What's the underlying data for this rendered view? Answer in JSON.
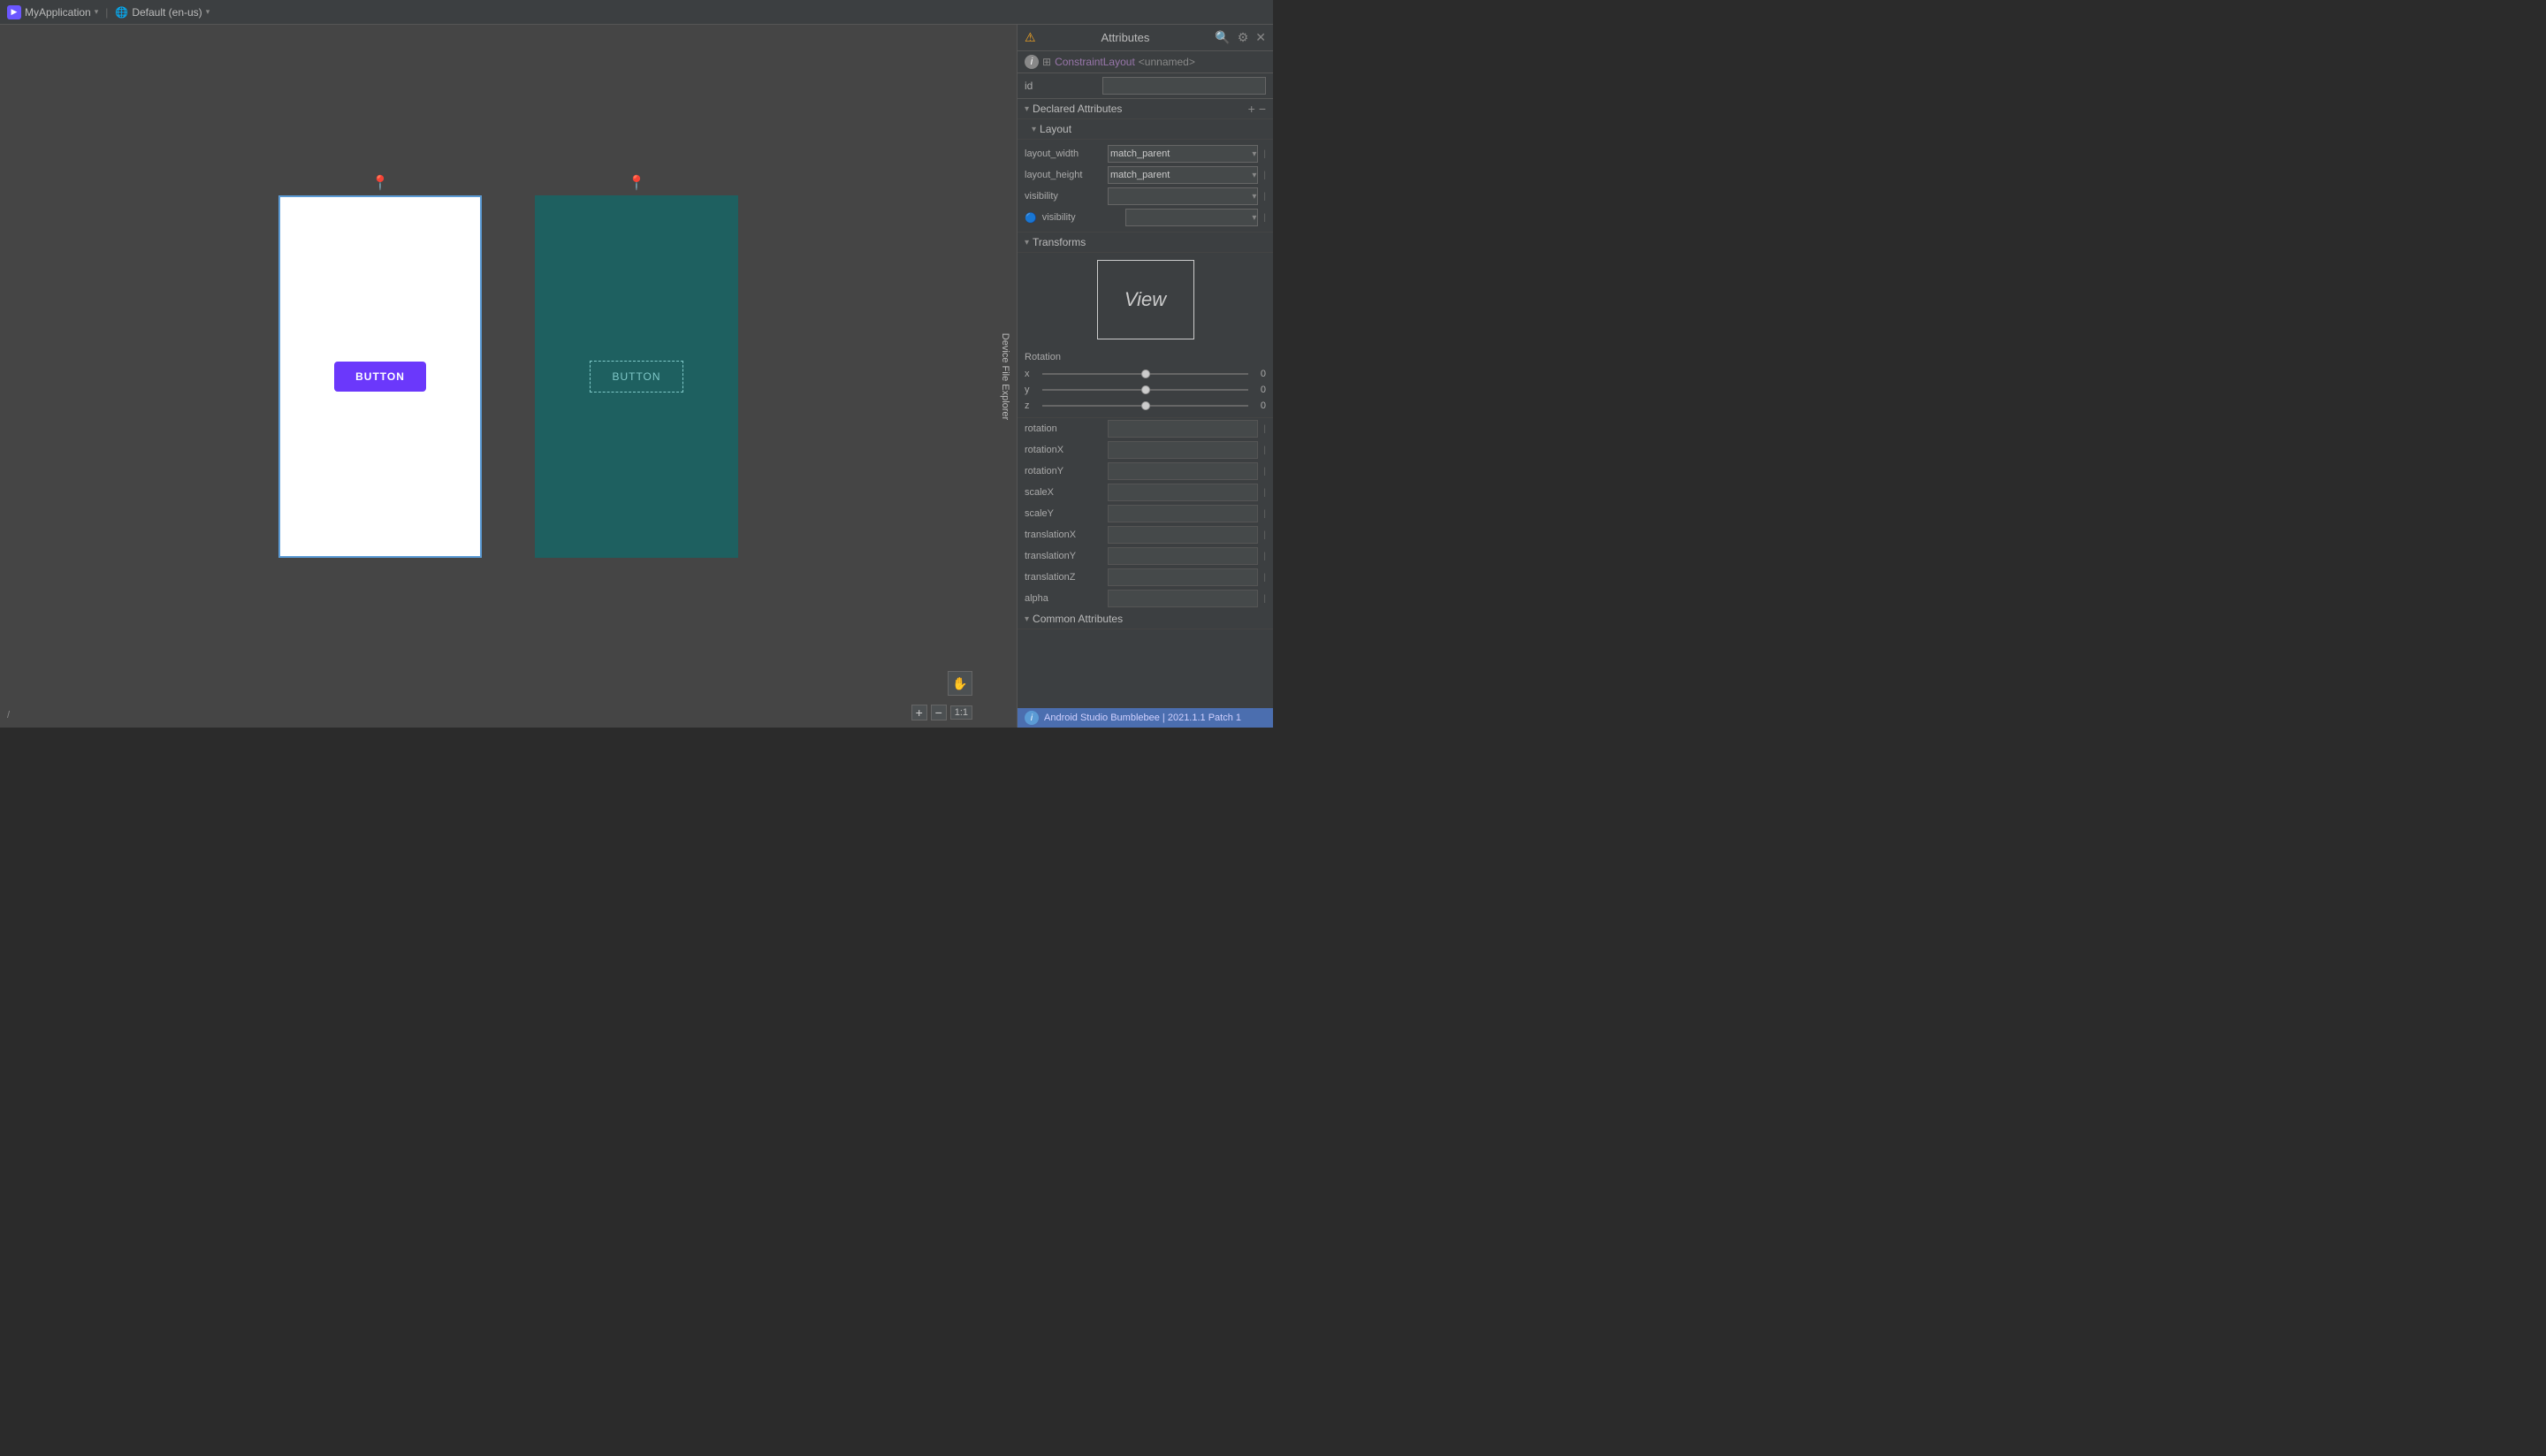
{
  "topbar": {
    "app_name": "MyApplication",
    "config_name": "Default (en-us)",
    "app_icon": "A",
    "chevron": "▾",
    "warning_label": "⚠"
  },
  "panel": {
    "title": "Attributes",
    "component_type": "ConstraintLayout",
    "component_name": "<unnamed>",
    "id_label": "id",
    "id_placeholder": "",
    "sections": {
      "declared_attributes": "Declared Attributes",
      "layout": "Layout",
      "transforms": "Transforms",
      "rotation_label": "Rotation",
      "common_attributes": "Common Attributes"
    },
    "layout": {
      "width_label": "layout_width",
      "width_value": "match_parent",
      "height_label": "layout_height",
      "height_value": "match_parent",
      "visibility_label": "visibility",
      "visibility2_label": "visibility"
    },
    "rotation": {
      "x_label": "x",
      "x_value": "0",
      "y_label": "y",
      "y_value": "0",
      "z_label": "z",
      "z_value": "0"
    },
    "transforms_attrs": [
      {
        "label": "rotation",
        "value": ""
      },
      {
        "label": "rotationX",
        "value": ""
      },
      {
        "label": "rotationY",
        "value": ""
      },
      {
        "label": "scaleX",
        "value": ""
      },
      {
        "label": "scaleY",
        "value": ""
      },
      {
        "label": "translationX",
        "value": ""
      },
      {
        "label": "translationY",
        "value": ""
      },
      {
        "label": "translationZ",
        "value": ""
      },
      {
        "label": "alpha",
        "value": ""
      }
    ],
    "view_label": "View"
  },
  "canvas": {
    "design_button_label": "BUTTON",
    "blueprint_button_label": "BUTTON",
    "zoom_ratio": "1:1"
  },
  "statusbar": {
    "text": "Android Studio Bumblebee | 2021.1.1 Patch 1"
  }
}
